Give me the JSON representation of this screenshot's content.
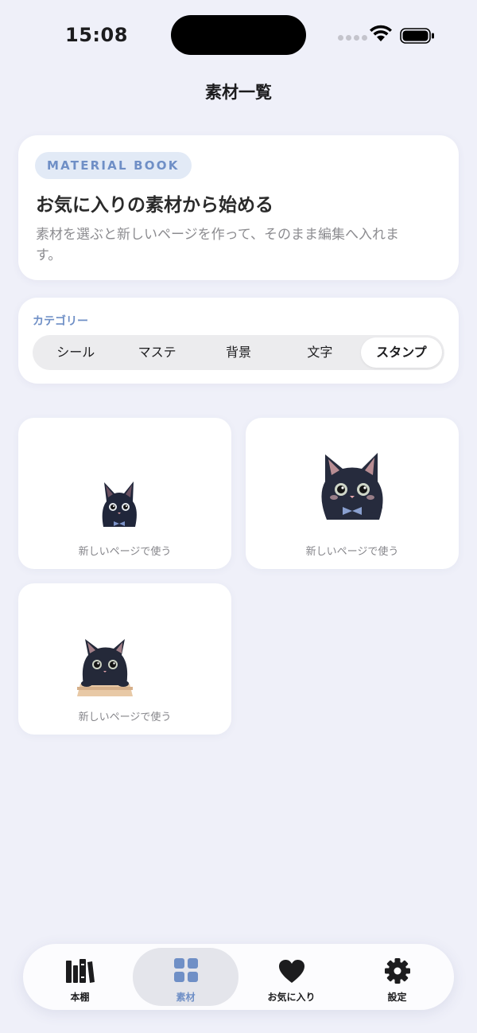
{
  "status_bar": {
    "time": "15:08"
  },
  "nav": {
    "title": "素材一覧"
  },
  "hero": {
    "badge": "MATERIAL BOOK",
    "title": "お気に入りの素材から始める",
    "description": "素材を選ぶと新しいページを作って、そのまま編集へ入れます。"
  },
  "category": {
    "label": "カテゴリー",
    "options": [
      "シール",
      "マステ",
      "背景",
      "文字",
      "スタンプ"
    ],
    "selected": "スタンプ"
  },
  "materials": [
    {
      "caption": "新しいページで使う",
      "image": "black-cat-sitting-sticker"
    },
    {
      "caption": "新しいページで使う",
      "image": "black-cat-waving-sticker"
    },
    {
      "caption": "新しいページで使う",
      "image": "black-cat-in-box-sticker"
    }
  ],
  "tabbar": {
    "items": [
      {
        "label": "本棚",
        "icon": "books-icon"
      },
      {
        "label": "素材",
        "icon": "grid-icon"
      },
      {
        "label": "お気に入り",
        "icon": "heart-icon"
      },
      {
        "label": "設定",
        "icon": "gear-icon"
      }
    ],
    "active": "素材"
  },
  "colors": {
    "background": "#eff0f9",
    "accent": "#6f8fc6",
    "card": "#ffffff"
  }
}
